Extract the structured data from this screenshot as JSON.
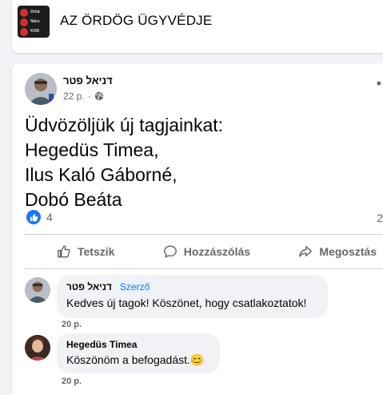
{
  "group": {
    "name": "AZ ÖRDÖG ÜGYVÉDJE",
    "thumb_lines": [
      "Orbá",
      "fides",
      "KOR"
    ]
  },
  "post": {
    "author": "דניאל פטר",
    "time": "22 p.",
    "separator": "·",
    "privacy_icon": "globe-icon",
    "more_icon": "•",
    "body_lines": [
      "Üdvözöljük új tagjainkat:",
      "Hegedüs Timea,",
      "Ilus Kaló Gáborné,",
      "Dobó Beáta"
    ],
    "reaction_count": "4",
    "comment_count": "2",
    "actions": {
      "like": "Tetszik",
      "comment": "Hozzászólás",
      "share": "Megosztás"
    }
  },
  "comments": [
    {
      "author": "דניאל פטר",
      "badge": "Szerző",
      "text": "Kedves új tagok! Köszönet, hogy csatlakoztatok!",
      "time": "20 p."
    },
    {
      "author": "Hegedüs Timea",
      "text": "Köszönöm a befogadást.😊",
      "time": "20 p."
    }
  ],
  "colors": {
    "accent": "#1877f2",
    "muted": "#65676b",
    "background": "#f0f2f5"
  }
}
